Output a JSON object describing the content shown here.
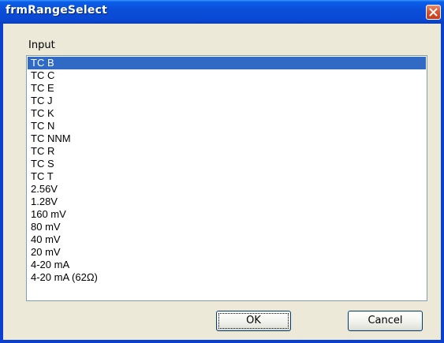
{
  "window": {
    "title": "frmRangeSelect"
  },
  "form": {
    "input_label": "Input",
    "list_items": [
      "TC B",
      "TC C",
      "TC E",
      "TC J",
      "TC K",
      "TC N",
      "TC NNM",
      "TC R",
      "TC S",
      "TC T",
      "2.56V",
      "1.28V",
      "160 mV",
      "80 mV",
      "40 mV",
      "20 mV",
      "4-20 mA",
      "4-20 mA (62Ω)"
    ],
    "selected_item": "TC B"
  },
  "buttons": {
    "ok_label": "OK",
    "cancel_label": "Cancel"
  },
  "colors": {
    "title_bar": "#0a4ed8",
    "selection": "#316ac5",
    "close_button": "#d8552f",
    "window_face": "#ece9d8"
  },
  "icons": {
    "close": "close-icon"
  }
}
